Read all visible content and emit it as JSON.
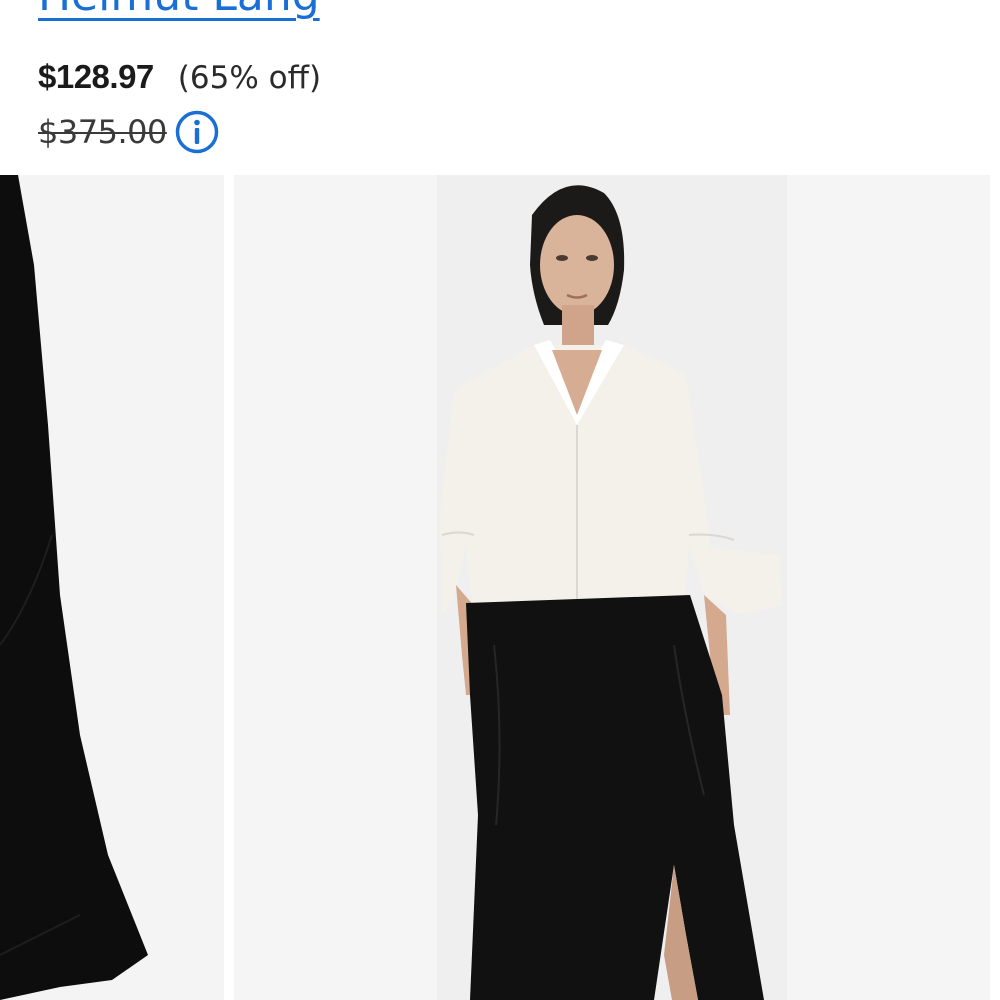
{
  "product": {
    "brand": "Helmut Lang",
    "price": "$128.97",
    "discount": "(65% off)",
    "original_price": "$375.00"
  },
  "icons": {
    "info": "info-circle-icon"
  },
  "colors": {
    "link": "#1a6fd6",
    "info_icon": "#1a6fd6",
    "price_text": "#1b1b1b",
    "photo_bg": "#f4f4f5"
  }
}
